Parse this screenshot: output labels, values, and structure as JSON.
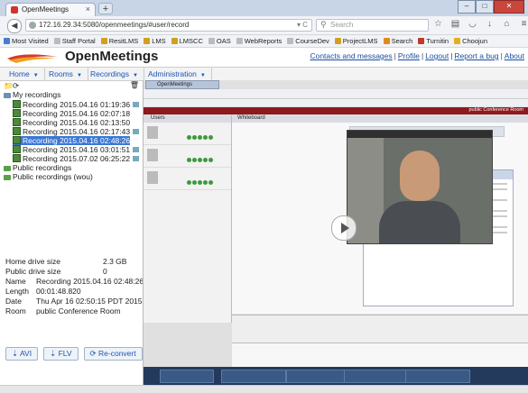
{
  "browser": {
    "tab_title": "OpenMeetings",
    "tab_close": "×",
    "new_tab": "+",
    "url": "172.16.29.34:5080/openmeetings/#user/record",
    "search_placeholder": "Search",
    "bookmarks": [
      "Most Visited",
      "Staff Portal",
      "ResitLMS",
      "LMS",
      "LMSCC",
      "OAS",
      "WebReports",
      "CourseDev",
      "ProjectLMS",
      "Search",
      "Turnitin",
      "Choojun"
    ]
  },
  "header": {
    "title": "OpenMeetings",
    "links": [
      "Contacts and messages",
      "Profile",
      "Logout",
      "Report a bug",
      "About"
    ]
  },
  "menu": {
    "items": [
      "Home",
      "Rooms",
      "Recordings",
      "Administration"
    ]
  },
  "tree": {
    "root": "My recordings",
    "recordings": [
      "Recording 2015.04.16 01:19:36",
      "Recording 2015.04.16 02:07:18",
      "Recording 2015.04.16 02:13:50",
      "Recording 2015.04.16 02:17:43",
      "Recording 2015.04.16 02:48:26",
      "Recording 2015.04.16 03:01:51",
      "Recording 2015.07.02 06:25:22"
    ],
    "selected_index": 4,
    "public": "Public recordings",
    "public_wou": "Public recordings (wou)"
  },
  "info": {
    "home_drive_label": "Home drive size",
    "home_drive_value": "2.3 GB",
    "public_drive_label": "Public drive size",
    "public_drive_value": "0",
    "name_label": "Name",
    "name_value": "Recording 2015.04.16 02:48:26",
    "length_label": "Length",
    "length_value": "00:01:48.820",
    "date_label": "Date",
    "date_value": "Thu Apr 16 02:50:15 PDT 2015",
    "room_label": "Room",
    "room_value": "public Conference Room"
  },
  "convert": {
    "avi": "AVI",
    "flv": "FLV",
    "reconvert": "Re-convert"
  },
  "player": {
    "inner_tab": "OpenMeetings",
    "inner_bar": "public Conference Room",
    "users_label": "Users",
    "whiteboard_label": "Whiteboard"
  },
  "colors": {
    "selected": "#3b78d6",
    "link": "#1a4fa0",
    "room_bar": "#8d1a1e"
  }
}
